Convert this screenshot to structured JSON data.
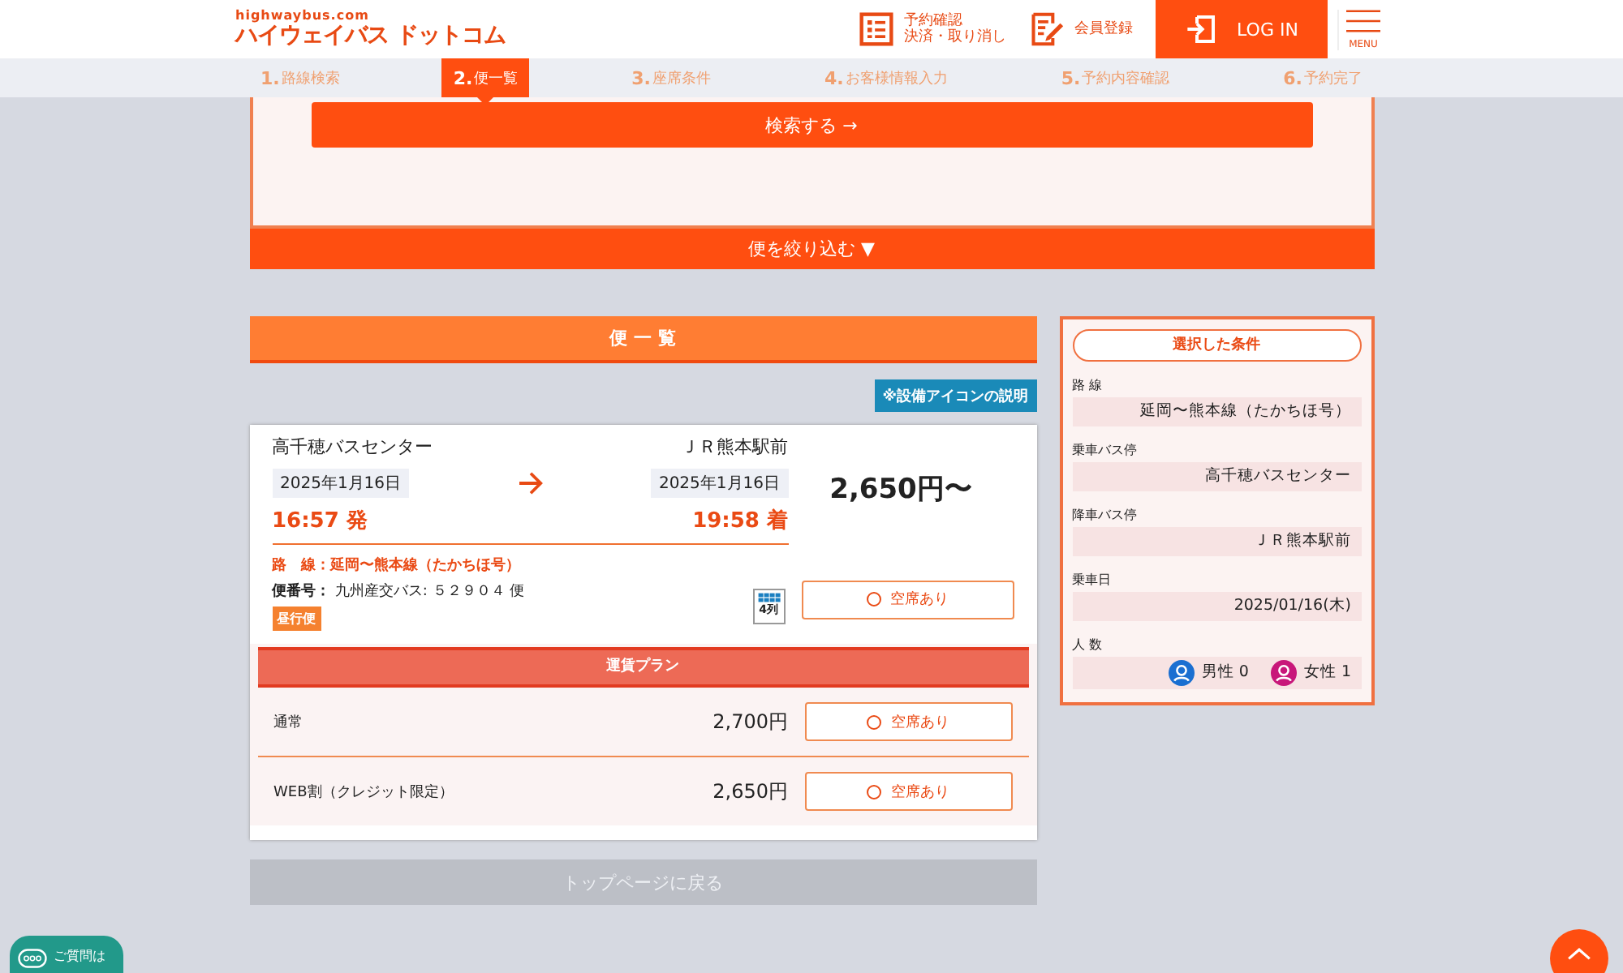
{
  "header": {
    "logo_sub": "highwaybus.com",
    "logo": "ハイウェイバス ドットコム",
    "links": [
      {
        "kind": "list",
        "lines": [
          "予約確認",
          "決済・取り消し"
        ]
      },
      {
        "kind": "edit",
        "lines": [
          "会員登録"
        ]
      }
    ],
    "login": "LOG IN",
    "menu": "MENU"
  },
  "steps": [
    {
      "num": "1.",
      "label": "路線検索",
      "selected": false
    },
    {
      "num": "2.",
      "label": "便一覧",
      "selected": true
    },
    {
      "num": "3.",
      "label": "座席条件",
      "selected": false
    },
    {
      "num": "4.",
      "label": "お客様情報入力",
      "selected": false
    },
    {
      "num": "5.",
      "label": "予約内容確認",
      "selected": false
    },
    {
      "num": "6.",
      "label": "予約完了",
      "selected": false
    }
  ],
  "search_button": "検索する →",
  "filter_button": "便を絞り込む ▼",
  "list_title": "便 一 覧",
  "facility_button": "※設備アイコンの説明",
  "trip": {
    "from": "高千穂バスセンター",
    "to": "ＪＲ熊本駅前",
    "dep_date": "2025年1月16日",
    "arr_date": "2025年1月16日",
    "dep_time": "16:57 発",
    "arr_time": "19:58 着",
    "price": "2,650円〜",
    "route_label": "路　線：",
    "route": "延岡〜熊本線（たかちほ号）",
    "number_label": "便番号：",
    "number": "九州産交バス: ５２９０４ 便",
    "tag": "昼行便",
    "seat_icon": "4列",
    "availability": "空席あり"
  },
  "fare_title": "運賃プラン",
  "fares": [
    {
      "name": "通常",
      "price": "2,700円",
      "availability": "空席あり"
    },
    {
      "name": "WEB割（クレジット限定）",
      "price": "2,650円",
      "availability": "空席あり"
    }
  ],
  "back_button": "トップページに戻る",
  "conditions": {
    "title": "選択した条件",
    "items": [
      {
        "heading": "路 線",
        "value": "延岡〜熊本線（たかちほ号）"
      },
      {
        "heading": "乗車バス停",
        "value": "高千穂バスセンター"
      },
      {
        "heading": "降車バス停",
        "value": "ＪＲ熊本駅前"
      },
      {
        "heading": "乗車日",
        "value": "2025/01/16(木)"
      }
    ],
    "people_label": "人 数",
    "people": [
      {
        "text": "男性 0",
        "color": "#1a6fd1"
      },
      {
        "text": "女性 1",
        "color": "#c8177a"
      }
    ]
  },
  "chat_button": "ご質問は"
}
